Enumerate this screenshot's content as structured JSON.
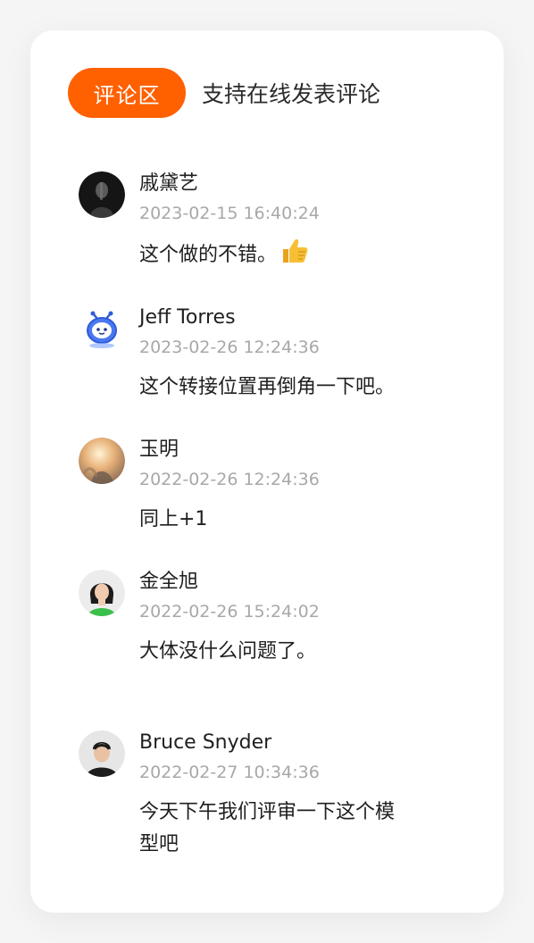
{
  "header": {
    "badge_label": "评论区",
    "subtitle": "支持在线发表评论"
  },
  "comments": [
    {
      "name": "戚黛艺",
      "time": "2023-02-15 16:40:24",
      "text": "这个做的不错。",
      "emoji": "thumbs-up-icon"
    },
    {
      "name": "Jeff Torres",
      "time": "2023-02-26 12:24:36",
      "text": "这个转接位置再倒角一下吧。"
    },
    {
      "name": "玉明",
      "time": "2022-02-26 12:24:36",
      "text": "同上+1"
    },
    {
      "name": "金全旭",
      "time": "2022-02-26 15:24:02",
      "text": "大体没什么问题了。"
    },
    {
      "name": "Bruce Snyder",
      "time": "2022-02-27 10:34:36",
      "text": "今天下午我们评审一下这个模型吧"
    }
  ],
  "colors": {
    "accent": "#ff6000",
    "time_text": "#a8a8a8"
  }
}
